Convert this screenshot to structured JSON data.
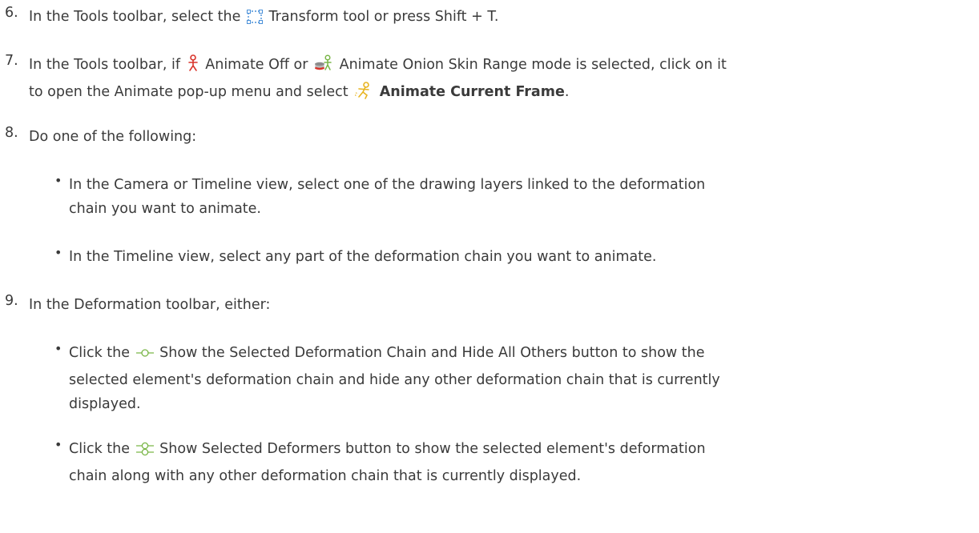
{
  "steps": [
    {
      "number": "6.",
      "text_a": "In the Tools toolbar, select the",
      "icon_transform": "transform-tool-icon",
      "text_b": "Transform tool or press Shift + T."
    },
    {
      "number": "7.",
      "line1_a": "In the Tools toolbar, if",
      "icon_animate_off": "animate-off-icon",
      "line1_b": "Animate Off or",
      "icon_onion_skin": "animate-onion-skin-range-icon",
      "line1_c": "Animate Onion Skin Range mode is selected, click on it",
      "line2_a": "to open the Animate pop-up menu and select",
      "icon_current_frame": "animate-current-frame-icon",
      "line2_bold": "Animate Current Frame",
      "line2_end": "."
    },
    {
      "number": "8.",
      "text": "Do one of the following:"
    },
    {
      "number": "9.",
      "text": "In the Deformation toolbar, either:"
    }
  ],
  "step8_bullets": [
    {
      "line1": "In the Camera or Timeline view, select one of the drawing layers linked to the deformation",
      "line2": "chain you want to animate."
    },
    {
      "line1": "In the Timeline view, select any part of the deformation chain you want to animate."
    }
  ],
  "step9_bullets": [
    {
      "prefix": "Click the",
      "icon": "show-selected-chain-hide-others-icon",
      "line1_rest": "Show the Selected Deformation Chain and Hide All Others button to show the",
      "line2": "selected element's deformation chain and hide any other deformation chain that is currently",
      "line3": "displayed."
    },
    {
      "prefix": "Click the",
      "icon": "show-selected-deformers-icon",
      "line1_rest": "Show Selected Deformers button to show the selected element's deformation",
      "line2": "chain along with any other deformation chain that is currently displayed."
    }
  ],
  "colors": {
    "text": "#3a3a3a",
    "animate_off_red": "#d9342b",
    "animate_current_yellow": "#e8b420",
    "transform_blue": "#4a90d9",
    "deformer_green": "#7ab648"
  }
}
